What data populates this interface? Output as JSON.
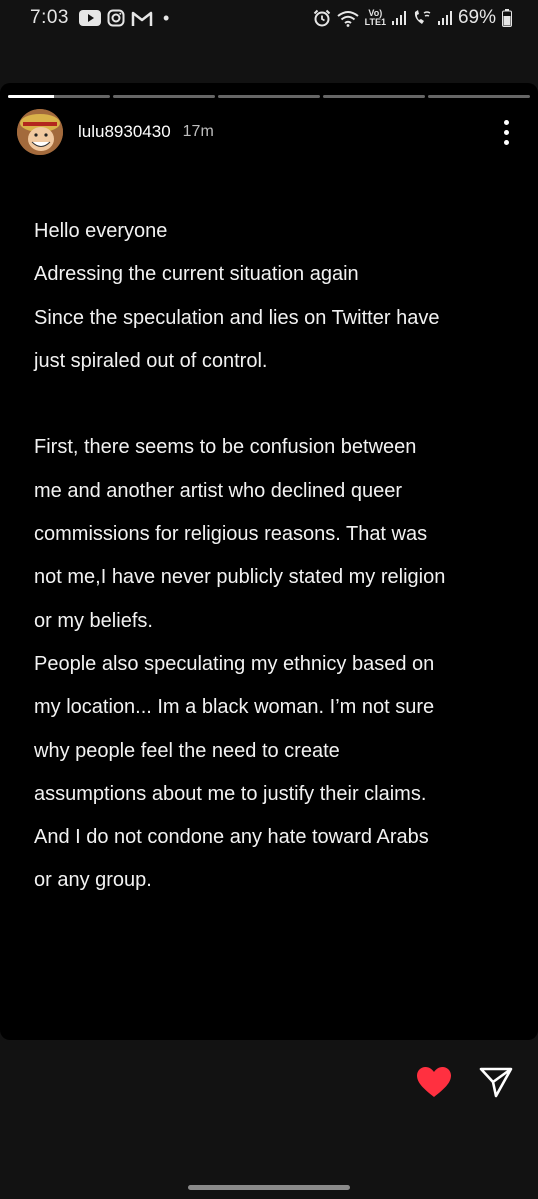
{
  "status_bar": {
    "time": "7:03",
    "battery": "69%",
    "volte": "Vo)",
    "lte": "LTE1",
    "dot": "•",
    "icons": [
      "youtube-icon",
      "instagram-icon",
      "gmail-icon",
      "notification-dot",
      "alarm-icon",
      "wifi-icon",
      "volte-icon",
      "signal-icon",
      "wifi-calling-icon",
      "signal-icon",
      "battery-icon"
    ]
  },
  "story": {
    "progress": {
      "segments": 5,
      "active_index": 0,
      "active_progress": 0.45
    },
    "username": "lulu8930430",
    "time_ago": "17m",
    "lines": [
      "Hello everyone",
      "Adressing the current situation again",
      "Since the speculation and lies on Twitter have",
      "just spiraled out of control.",
      "",
      "First, there seems to be confusion between",
      "me and another artist who declined queer",
      "commissions for religious reasons. That was",
      "not me,I have never publicly stated my religion",
      "or my beliefs.",
      "People also speculating my ethnicy based on",
      "my location... Im a black woman. I’m not sure",
      "why people feel the need to create",
      "assumptions about me to justify their claims.",
      "And I do not condone any hate toward Arabs",
      "or any group."
    ]
  },
  "actions": {
    "like_color": "#ff3040",
    "like_icon": "heart-icon",
    "share_icon": "send-icon"
  },
  "colors": {
    "background": "#121212",
    "story_background": "#000000",
    "accent_like": "#ff3040"
  }
}
